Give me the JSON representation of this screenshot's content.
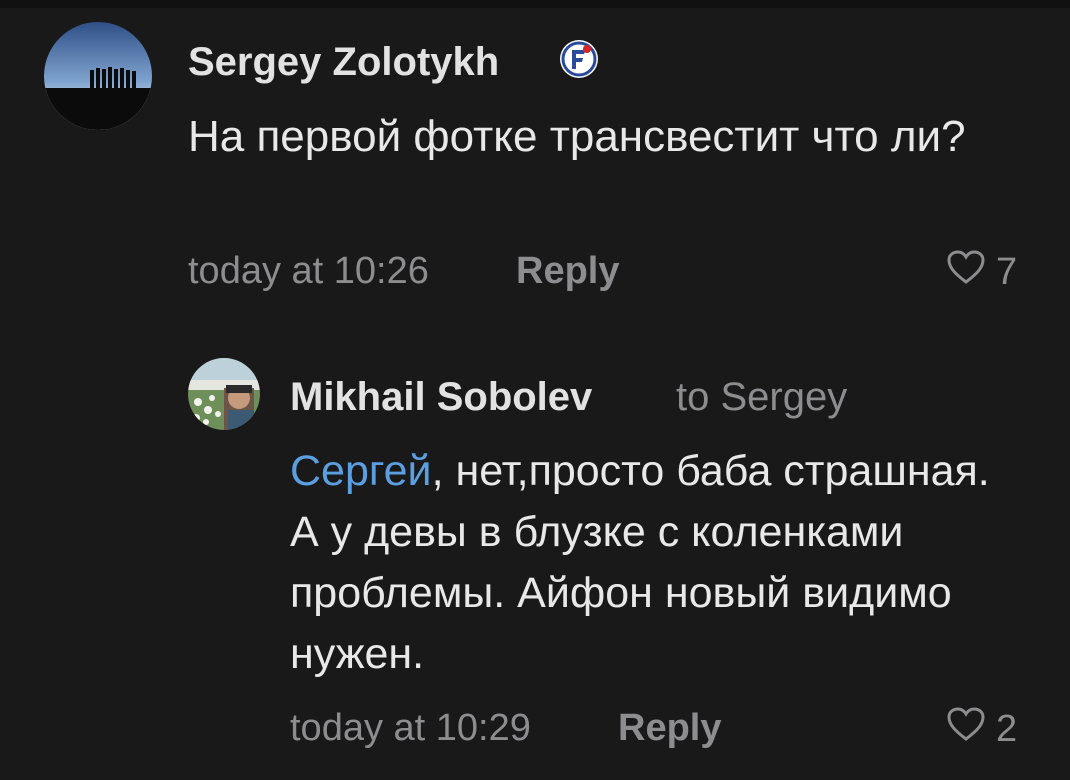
{
  "comments": [
    {
      "author": "Sergey Zolotykh",
      "text": "На первой фотке трансвестит что ли?",
      "time": "today at 10:26",
      "reply_label": "Reply",
      "likes": "7"
    }
  ],
  "reply": {
    "author": "Mikhail Sobolev",
    "to": "to Sergey",
    "mention": "Сергей",
    "text": ", нет,просто баба страшная. А у девы в блузке с коленками проблемы. Айфон новый видимо нужен.",
    "time": "today at 10:29",
    "reply_label": "Reply",
    "likes": "2"
  },
  "colors": {
    "background": "#19191a",
    "mention": "#5b9fe0",
    "muted": "#8d8d8f"
  },
  "icons": {
    "like": "heart-outline-icon",
    "badge": "verified-badge-icon"
  }
}
